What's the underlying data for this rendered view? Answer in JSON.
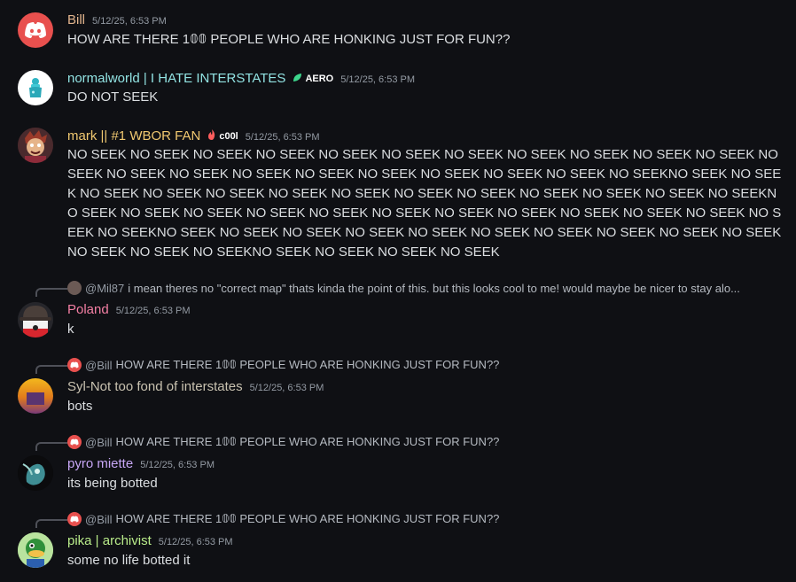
{
  "messages": [
    {
      "username": "Bill",
      "username_color": "#e3b58e",
      "timestamp": "5/12/25, 6:53 PM",
      "text": "HOW ARE THERE 1𝟘𝟘 PEOPLE WHO ARE HONKING  JUST FOR FUN??",
      "avatar": "discord-logo-icon"
    },
    {
      "username": "normalworld | I HATE INTERSTATES",
      "username_color": "#92e3e3",
      "tag": "AERO",
      "tag_icon": "leaf-icon",
      "timestamp": "5/12/25, 6:53 PM",
      "text": "DO NOT SEEK",
      "avatar": "teal-figure-avatar"
    },
    {
      "username": "mark || #1 WBOR FAN",
      "username_color": "#f0c870",
      "tag": "c00l",
      "tag_icon": "fire-icon",
      "timestamp": "5/12/25, 6:53 PM",
      "text": "NO SEEK NO SEEK NO SEEK NO SEEK NO SEEK NO SEEK NO SEEK NO SEEK NO SEEK NO SEEK NO SEEK NO SEEK NO SEEK NO SEEK NO SEEK NO SEEK NO SEEK NO SEEK NO SEEK NO SEEK NO SEEKNO SEEK NO SEEK NO SEEK NO SEEK NO SEEK NO SEEK NO SEEK NO SEEK NO SEEK NO SEEK NO SEEK NO SEEK NO SEEKNO SEEK NO SEEK NO SEEK NO SEEK NO SEEK NO SEEK NO SEEK NO SEEK NO SEEK NO SEEK NO SEEK NO SEEK NO SEEKNO SEEK NO SEEK NO SEEK NO SEEK NO SEEK NO SEEK NO SEEK NO SEEK NO SEEK NO SEEK NO SEEK NO SEEK NO SEEKNO SEEK NO SEEK NO SEEK NO SEEK",
      "avatar": "cartoon-character-avatar"
    },
    {
      "reply_to": "@Mil87",
      "reply_text": "i mean theres no \"correct map\" thats kinda the point of this. but this looks cool to me! would maybe be nicer to stay alo...",
      "username": "Poland",
      "username_color": "#f47fa4",
      "timestamp": "5/12/25, 6:53 PM",
      "text": "k",
      "avatar": "hat-avatar"
    },
    {
      "reply_to": "@Bill",
      "reply_text": "HOW ARE THERE 1𝟘𝟘 PEOPLE WHO ARE HONKING  JUST FOR FUN??",
      "username": "Syl-Not too fond of interstates",
      "username_color": "#c9c2b0",
      "timestamp": "5/12/25, 6:53 PM",
      "text": "bots",
      "avatar": "sunset-avatar"
    },
    {
      "reply_to": "@Bill",
      "reply_text": "HOW ARE THERE 1𝟘𝟘 PEOPLE WHO ARE HONKING  JUST FOR FUN??",
      "username": "pyro miette",
      "username_color": "#c7a6f5",
      "timestamp": "5/12/25, 6:53 PM",
      "text": "its being botted",
      "avatar": "creature-avatar"
    },
    {
      "reply_to": "@Bill",
      "reply_text": "HOW ARE THERE 1𝟘𝟘 PEOPLE WHO ARE HONKING  JUST FOR FUN??",
      "username": "pika | archivist",
      "username_color": "#b9ec8a",
      "timestamp": "5/12/25, 6:53 PM",
      "text": "some no life botted it",
      "avatar": "duck-avatar"
    }
  ]
}
